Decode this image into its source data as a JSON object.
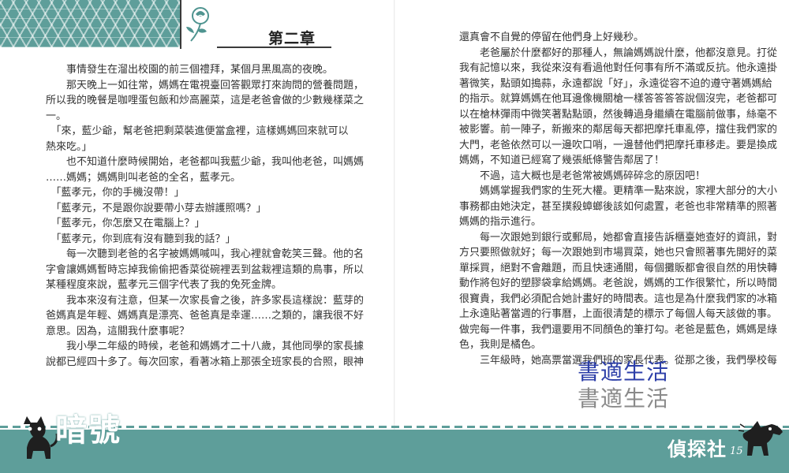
{
  "chapter": {
    "title": "第二章"
  },
  "left_page": {
    "lines": [
      "　　事情發生在溜出校園的前三個禮拜，某個月黑風高的夜晚。",
      "　　那天晚上一如往常，媽媽在電視臺回答觀眾打來詢問的營養問題，",
      "所以我的晚餐是咖哩蛋包飯和炒高麗菜，這是老爸會做的少數幾樣菜之",
      "一。",
      "　「來，藍少爺，幫老爸把剩菜裝進便當盒裡，這樣媽媽回來就可以",
      "熱來吃。」",
      "　　也不知道什麼時候開始，老爸都叫我藍少爺，我叫他老爸，叫媽媽",
      "……媽媽；媽媽則叫老爸的全名，藍孝元。",
      "　「藍孝元，你的手機沒帶！」",
      "　「藍孝元，不是跟你說要帶小芽去辦護照嗎？」",
      "　「藍孝元，你怎麼又在電腦上？」",
      "　「藍孝元，你到底有沒有聽到我的話？」",
      "　　每一次聽到老爸的名字被媽媽喊叫，我心裡就會乾笑三聲。他的名",
      "字會讓媽媽暫時忘掉我偷偷把香菜從碗裡丟到盆栽裡這類的鳥事，所以",
      "某種程度來說，藍孝元三個字代表了我的免死金牌。",
      "　　我本來沒有注意，但某一次家長會之後，許多家長這樣說：藍芽的",
      "爸媽真是年輕、媽媽真是漂亮、爸爸真是幸運……之類的，讓我很不好",
      "意思。因為，這關我什麼事呢？",
      "　　我小學二年級的時候，老爸和媽媽才二十八歲，其他同學的家長據",
      "說都已經四十多了。每次回家，看著冰箱上那張全班家長的合照，眼神"
    ]
  },
  "right_page": {
    "lines": [
      "還真會不自覺的停留在他們身上好幾秒。",
      "　　老爸屬於什麼都好的那種人，無論媽媽說什麼，他都沒意見。打從",
      "我有記憶以來，我從來沒有看過他對任何事有所不滿或反抗。他永遠掛",
      "著微笑，點頭如搗蒜，永遠都說「好」，永遠從容不迫的遵守著媽媽給",
      "的指示。就算媽媽在他耳邊像機關槍一樣答答答答說個沒完，老爸都可",
      "以在槍林彈雨中微笑著點點頭，然後轉過身繼續在電腦前做事，絲毫不",
      "被影響。前一陣子，新搬來的鄰居每天都把摩托車亂停，擋住我們家的",
      "大門，老爸依然可以一邊吹口哨，一邊替他們把摩托車移走。要是換成",
      "媽媽，不知道已經寫了幾張紙條警告鄰居了！",
      "　　不過，這大概也是老爸常被媽媽碎碎念的原因吧！",
      "　　媽媽掌握我們家的生死大權。更精準一點來說，家裡大部分的大小",
      "事務都由她決定，甚至撲殺蟑螂後該如何處置，老爸也非常精準的照著",
      "媽媽的指示進行。",
      "　　每一次跟她到銀行或郵局，她都會直接告訴櫃臺她查好的資訊，對",
      "方只要照做就好；每一次跟她到市場買菜，她也只會照著事先開好的菜",
      "單採買，絕對不會離題，而且快速通關，每個攤販都會很自然的用快轉",
      "動作將包好的塑膠袋拿給媽媽。老爸說，媽媽的工作很繁忙，所以時間",
      "很寶貴，我們必須配合她計畫好的時間表。這也是為什麼我們家的冰箱",
      "上永遠貼著當週的行事曆，上面很清楚的標示了每個人每天該做的事。",
      "做完每一件事，我們還要用不同顏色的筆打勾。老爸是藍色，媽媽是綠",
      "色，我則是橘色。",
      "　　三年級時，她高票當選我們班的家長代表。從那之後，我們學校每"
    ]
  },
  "watermark": {
    "line1": "書適生活",
    "line2": "書適生活"
  },
  "footer": {
    "series_left": "暗號",
    "series_right": "偵探社",
    "page_number": "15"
  },
  "colors": {
    "accent": "#5e9e9a",
    "watermark_blue": "#2c3ea8",
    "watermark_gray": "#8a8a8a"
  },
  "icons": [
    "rose-icon",
    "cat-icon",
    "dog-icon"
  ]
}
